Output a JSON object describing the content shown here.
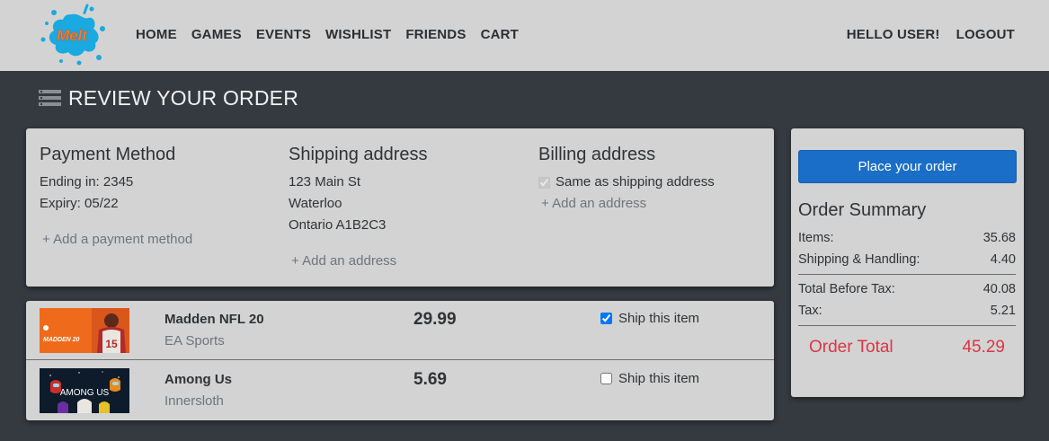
{
  "brand": {
    "logo_text": "Melt",
    "logo_color": "#f47b37",
    "splash_color": "#1aa9e0"
  },
  "nav": {
    "links": [
      "HOME",
      "GAMES",
      "EVENTS",
      "WISHLIST",
      "FRIENDS",
      "CART"
    ],
    "greeting": "HELLO USER!",
    "logout": "LOGOUT"
  },
  "page": {
    "title": "REVIEW YOUR ORDER",
    "icon": "list-icon"
  },
  "payment": {
    "heading": "Payment Method",
    "ending": "Ending in: 2345",
    "expiry": "Expiry: 05/22",
    "add_link": "+ Add a payment method"
  },
  "shipping": {
    "heading": "Shipping address",
    "street": "123 Main St",
    "city": "Waterloo",
    "region": "Ontario A1B2C3",
    "add_link": "+ Add an address"
  },
  "billing": {
    "heading": "Billing address",
    "same_label": "Same as shipping address",
    "same_checked": true,
    "add_link": "+ Add an address"
  },
  "items": [
    {
      "name": "Madden NFL 20",
      "maker": "EA Sports",
      "price": "29.99",
      "ship_label": "Ship this item",
      "ship_checked": true,
      "thumb_caption": "MADDEN 20",
      "thumb_number": "15"
    },
    {
      "name": "Among Us",
      "maker": "Innersloth",
      "price": "5.69",
      "ship_label": "Ship this item",
      "ship_checked": false,
      "thumb_caption": "AMONG US"
    }
  ],
  "summary": {
    "button": "Place your order",
    "title": "Order Summary",
    "items_label": "Items:",
    "items_value": "35.68",
    "shipping_label": "Shipping & Handling:",
    "shipping_value": "4.40",
    "before_tax_label": "Total Before Tax:",
    "before_tax_value": "40.08",
    "tax_label": "Tax:",
    "tax_value": "5.21",
    "total_label": "Order Total",
    "total_value": "45.29"
  },
  "colors": {
    "accent": "#1a6ec8",
    "total": "#dc3545",
    "background": "#343a40",
    "panel": "#d3d3d3"
  }
}
